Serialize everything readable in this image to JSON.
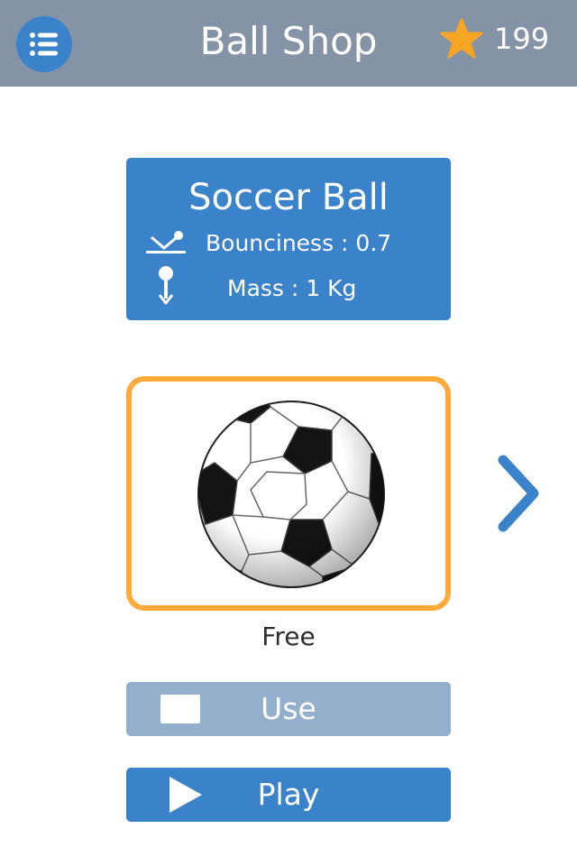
{
  "header": {
    "title": "Ball Shop",
    "coins": "199",
    "menu_icon": "list-icon",
    "currency_icon": "star-icon"
  },
  "ball": {
    "name": "Soccer Ball",
    "bounciness_label": "Bounciness : 0.7",
    "mass_label": "Mass : 1 Kg",
    "bounciness_icon": "bounce-icon",
    "mass_icon": "weight-icon",
    "price": "Free"
  },
  "actions": {
    "use_label": "Use",
    "play_label": "Play",
    "next_icon": "chevron-right-icon"
  },
  "colors": {
    "header_bg": "#8593a6",
    "primary_blue": "#3a82c9",
    "selection_orange": "#ffa93a",
    "disabled_blue": "#93afcc",
    "star_yellow": "#f6a623"
  }
}
